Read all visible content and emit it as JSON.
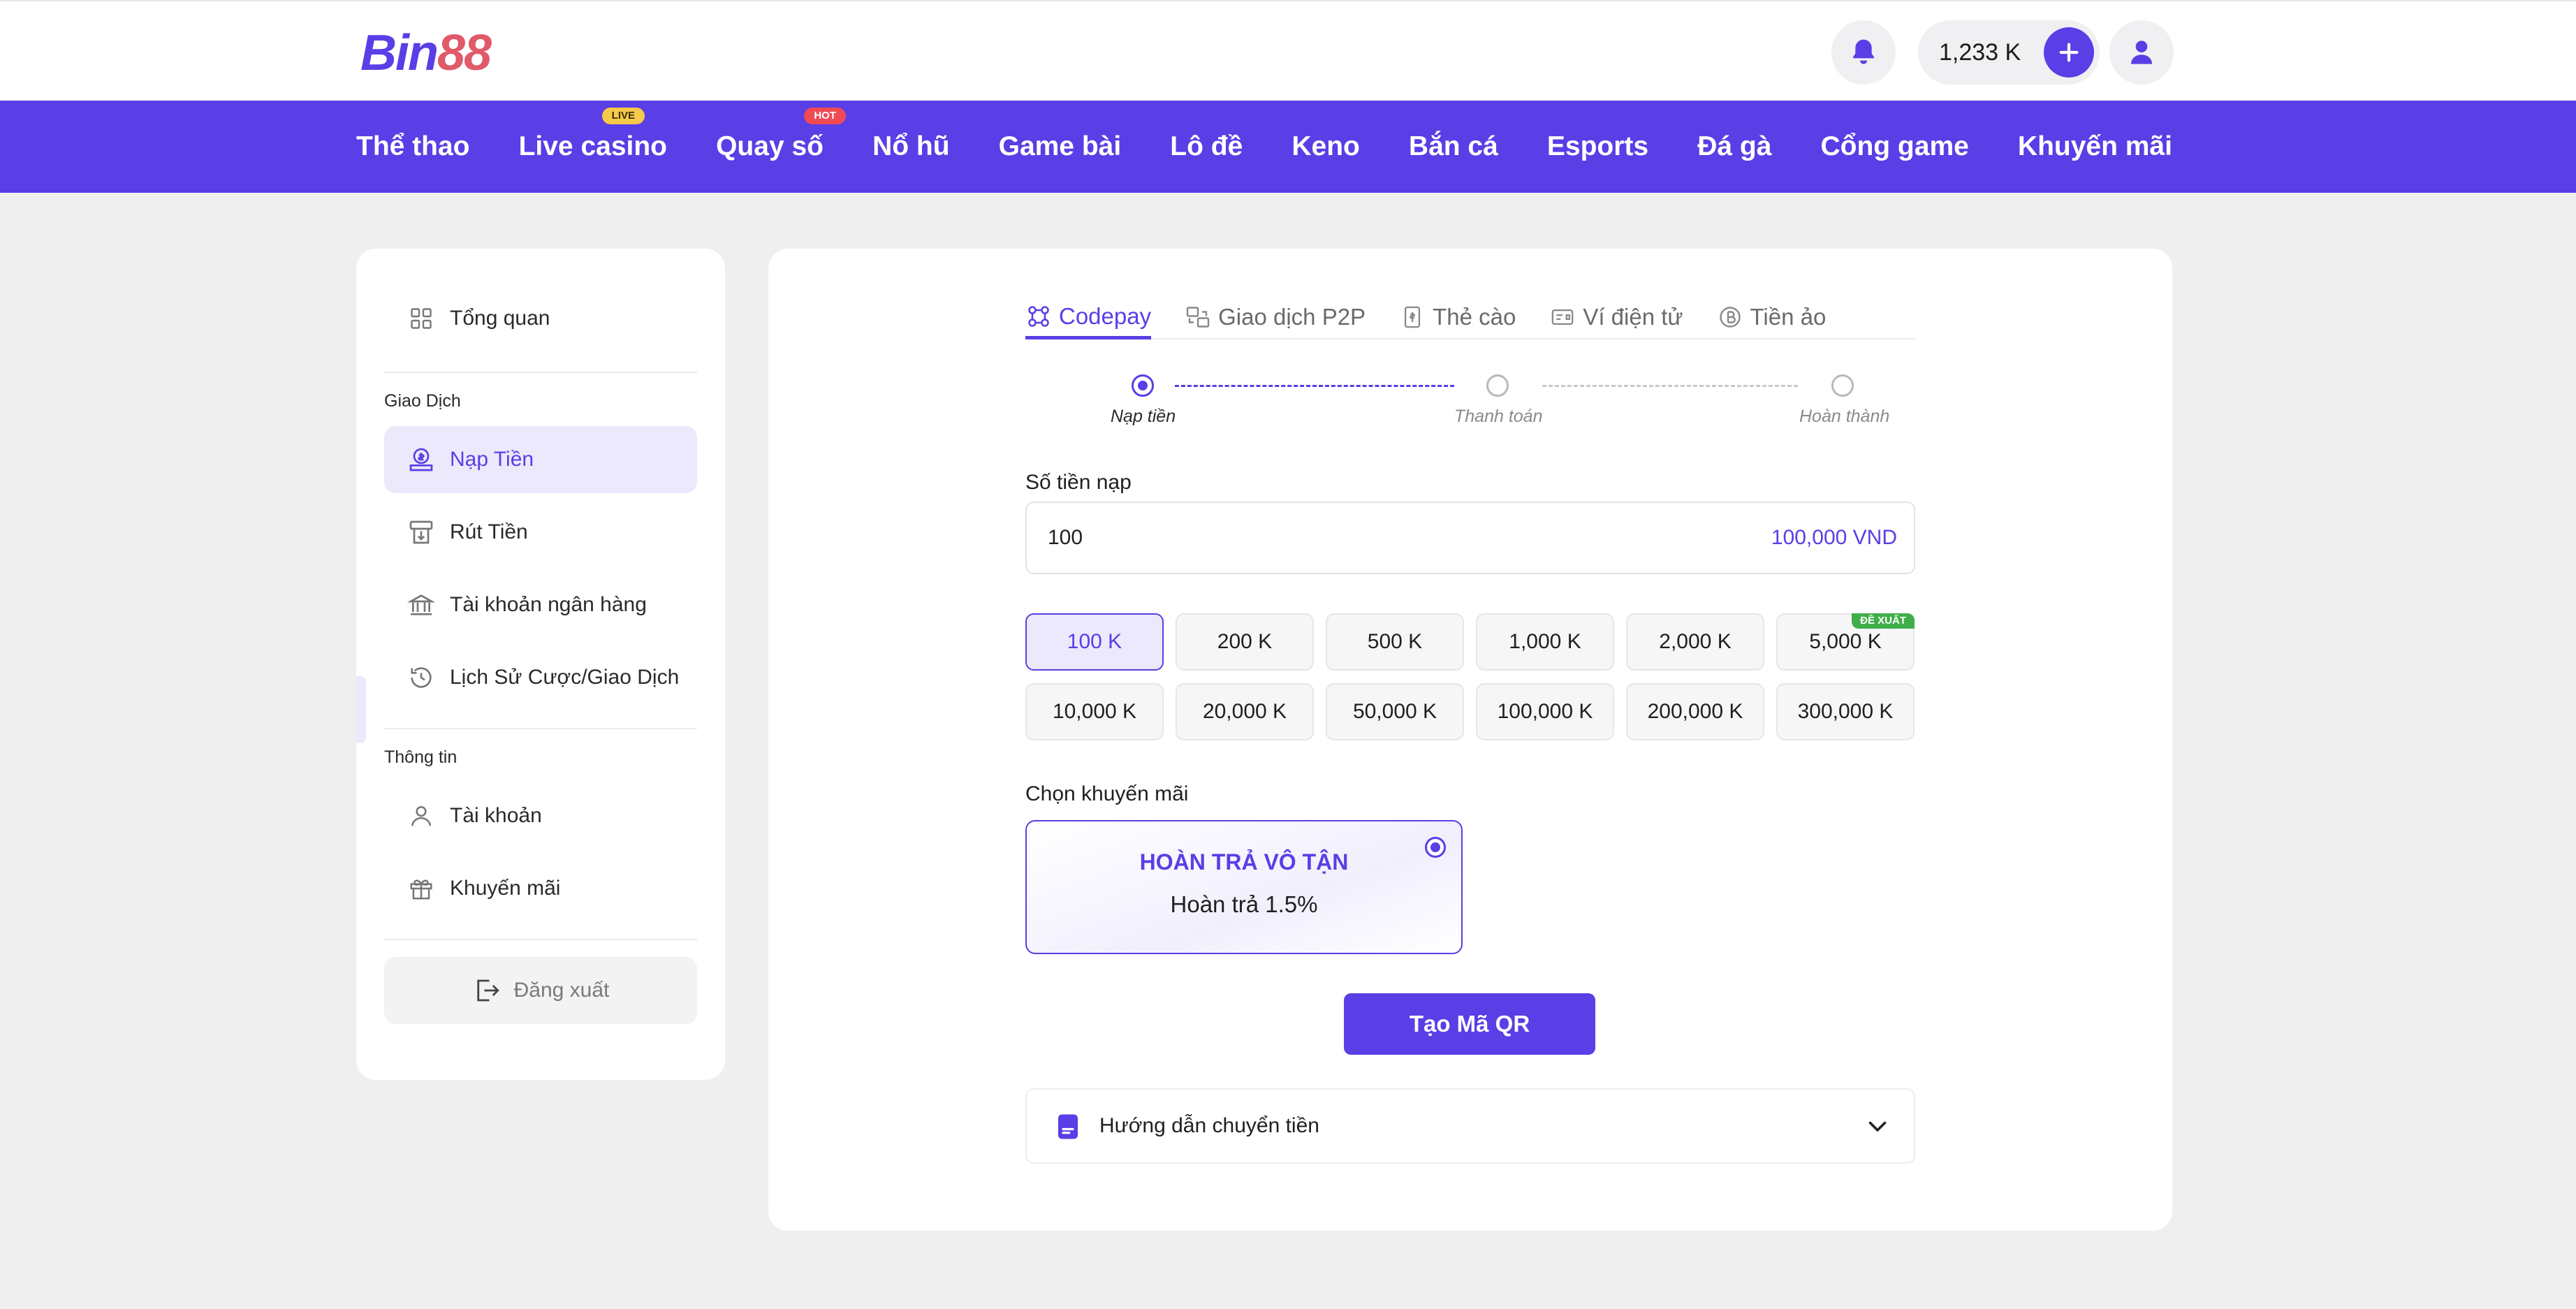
{
  "header": {
    "logo_part1": "Bin",
    "logo_part2": "88",
    "balance": "1,233 K",
    "icons": [
      "bell-icon",
      "plus-icon",
      "user-icon"
    ]
  },
  "nav": {
    "items": [
      {
        "label": "Thể thao"
      },
      {
        "label": "Live casino",
        "badge": "LIVE"
      },
      {
        "label": "Quay số",
        "badge": "HOT"
      },
      {
        "label": "Nổ hũ"
      },
      {
        "label": "Game bài"
      },
      {
        "label": "Lô đề"
      },
      {
        "label": "Keno"
      },
      {
        "label": "Bắn cá"
      },
      {
        "label": "Esports"
      },
      {
        "label": "Đá gà"
      },
      {
        "label": "Cổng game"
      },
      {
        "label": "Khuyến mãi"
      }
    ]
  },
  "sidebar": {
    "overview": "Tổng quan",
    "group_transactions": "Giao Dịch",
    "deposit": "Nạp Tiền",
    "withdraw": "Rút Tiền",
    "bank_account": "Tài khoản ngân hàng",
    "history": "Lịch Sử Cược/Giao Dịch",
    "group_info": "Thông tin",
    "account": "Tài khoản",
    "promotions": "Khuyến mãi",
    "logout": "Đăng xuất",
    "active_item": "deposit"
  },
  "tabs": [
    {
      "label": "Codepay",
      "icon": "codepay-icon",
      "active": true
    },
    {
      "label": "Giao dịch P2P",
      "icon": "p2p-icon",
      "active": false
    },
    {
      "label": "Thẻ cào",
      "icon": "card-icon",
      "active": false
    },
    {
      "label": "Ví điện tử",
      "icon": "wallet-icon",
      "active": false
    },
    {
      "label": "Tiền ảo",
      "icon": "crypto-icon",
      "active": false
    }
  ],
  "stepper": {
    "steps": [
      "Nạp tiền",
      "Thanh toán",
      "Hoàn thành"
    ],
    "current": 1
  },
  "form": {
    "amount_label": "Số tiền nạp",
    "amount_value": "100",
    "amount_converted": "100,000 VND",
    "chips": [
      "100 K",
      "200 K",
      "500 K",
      "1,000 K",
      "2,000 K",
      "5,000 K",
      "10,000 K",
      "20,000 K",
      "50,000 K",
      "100,000 K",
      "200,000 K",
      "300,000 K"
    ],
    "selected_chip": "100 K",
    "suggested_chip": "5,000 K",
    "suggested_badge": "ĐỀ XUẤT",
    "promo_label": "Chọn khuyến mãi",
    "promo_title": "HOÀN TRẢ VÔ TẬN",
    "promo_subtitle": "Hoàn trả 1.5%",
    "submit": "Tạo Mã QR",
    "guide": "Hướng dẫn chuyển tiền"
  },
  "colors": {
    "brand": "#5a3ee6",
    "brand_light": "#ece9fc",
    "badge_live": "#f5c94a",
    "badge_hot": "#f04a55",
    "badge_suggest": "#3fae49"
  }
}
